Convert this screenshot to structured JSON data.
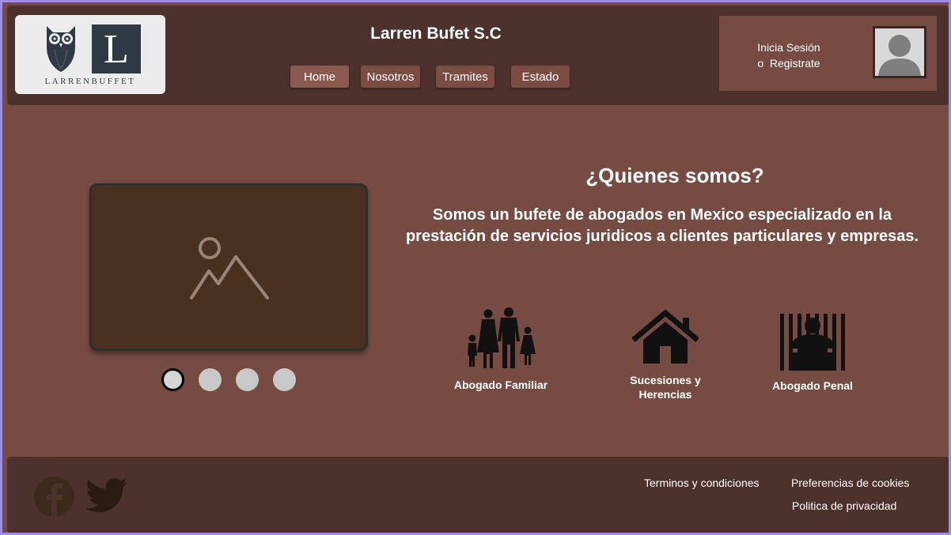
{
  "header": {
    "logo_letter": "L",
    "logo_text": "LARRENBUFFET",
    "site_title": "Larren Bufet S.C",
    "nav": [
      "Home",
      "Nosotros",
      "Tramites",
      "Estado"
    ],
    "login_line1": "Inicia Sesión",
    "login_line2": "o  Registrate"
  },
  "carousel": {
    "image_icon": "image-placeholder-icon",
    "slides": 4,
    "active": 1
  },
  "about": {
    "title": "¿Quienes somos?",
    "description": "Somos un bufete de abogados en Mexico especializado en la prestación de servicios juridicos a clientes particulares y empresas."
  },
  "services": [
    {
      "label": "Abogado Familiar",
      "icon": "family-icon"
    },
    {
      "label": "Sucesiones y Herencias",
      "icon": "house-icon"
    },
    {
      "label": "Abogado Penal",
      "icon": "prisoner-icon"
    }
  ],
  "footer": {
    "terms": "Terminos y condiciones",
    "cookies": "Preferencias de cookies",
    "privacy": "Politica de privacidad",
    "social": [
      "facebook-icon",
      "twitter-icon"
    ]
  },
  "colors": {
    "page_bg": "#764b42",
    "header_bg": "#4d312d",
    "footer_bg": "#4d312d",
    "frame_border": "#9d8fe6"
  }
}
